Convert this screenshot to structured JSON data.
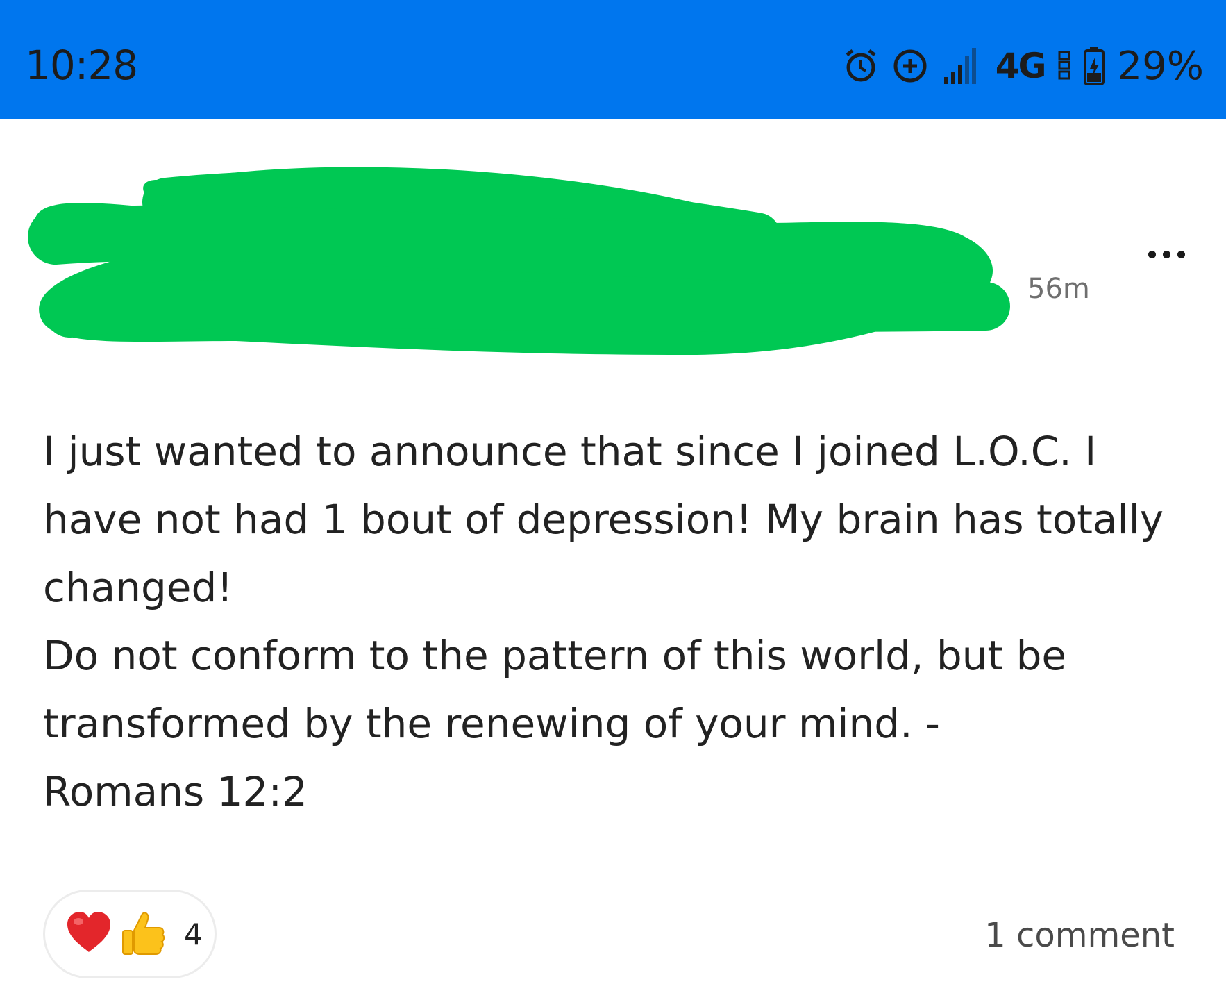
{
  "status_bar": {
    "time": "10:28",
    "network": "4G",
    "battery_percent": "29%",
    "icons": [
      "alarm-icon",
      "data-saver-icon",
      "signal-icon",
      "volte-icon",
      "battery-charging-icon"
    ],
    "background_color": "#0076ee"
  },
  "post": {
    "timestamp": "56m",
    "author_redacted_color": "#00c853",
    "body_lines": [
      "I just wanted to announce that since I joined L.O.C. I have not had 1 bout of depression! My brain has totally changed!",
      "Do not conform to the pattern of this world, but be transformed by the renewing of your mind. -",
      "Romans 12:2"
    ],
    "reactions": {
      "icons": [
        "heart-icon",
        "thumbs-up-icon"
      ],
      "count": "4"
    },
    "comments_label": "1 comment"
  }
}
